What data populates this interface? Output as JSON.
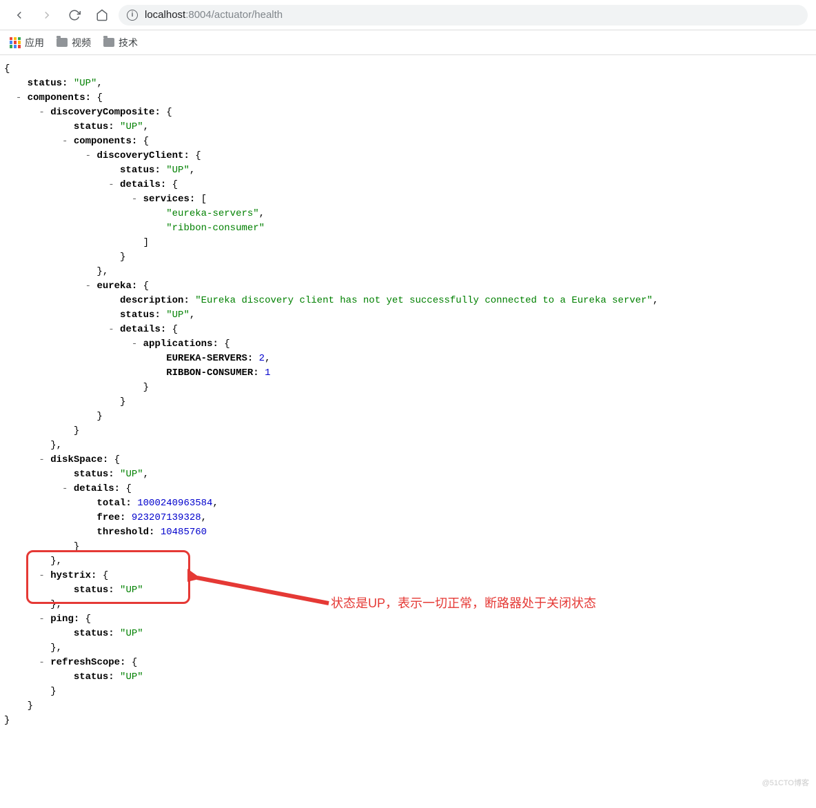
{
  "url": {
    "host": "localhost",
    "port_path": ":8004/actuator/health"
  },
  "bookmarks": {
    "apps": "应用",
    "video": "视频",
    "tech": "技术"
  },
  "json": {
    "status_k": "status: ",
    "status_v": "\"UP\"",
    "components_k": "components: ",
    "discComp_k": "discoveryComposite: ",
    "dc_status_k": "status: ",
    "dc_status_v": "\"UP\"",
    "dc_components_k": "components: ",
    "discClient_k": "discoveryClient: ",
    "dcc_status_k": "status: ",
    "dcc_status_v": "\"UP\"",
    "dcc_details_k": "details: ",
    "services_k": "services: ",
    "service1": "\"eureka-servers\"",
    "service2": "\"ribbon-consumer\"",
    "eureka_k": "eureka: ",
    "eureka_desc_k": "description: ",
    "eureka_desc_v": "\"Eureka discovery client has not yet successfully connected to a Eureka server\"",
    "eureka_status_k": "status: ",
    "eureka_status_v": "\"UP\"",
    "eureka_details_k": "details: ",
    "applications_k": "applications: ",
    "app1_k": "EUREKA-SERVERS: ",
    "app1_v": "2",
    "app2_k": "RIBBON-CONSUMER: ",
    "app2_v": "1",
    "diskSpace_k": "diskSpace: ",
    "ds_status_k": "status: ",
    "ds_status_v": "\"UP\"",
    "ds_details_k": "details: ",
    "total_k": "total: ",
    "total_v": "1000240963584",
    "free_k": "free: ",
    "free_v": "923207139328",
    "threshold_k": "threshold: ",
    "threshold_v": "10485760",
    "hystrix_k": "hystrix: ",
    "hy_status_k": "status: ",
    "hy_status_v": "\"UP\"",
    "ping_k": "ping: ",
    "ping_status_k": "status: ",
    "ping_status_v": "\"UP\"",
    "refresh_k": "refreshScope: ",
    "rs_status_k": "status: ",
    "rs_status_v": "\"UP\""
  },
  "annotation": "状态是UP，表示一切正常，断路器处于关闭状态",
  "watermark": "@51CTO博客"
}
